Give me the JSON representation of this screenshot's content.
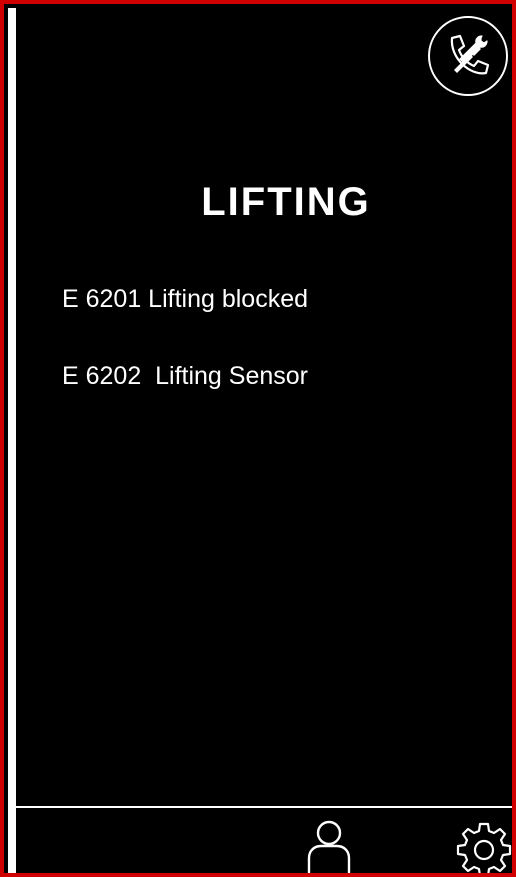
{
  "screen": {
    "title": "LIFTING"
  },
  "errors": [
    {
      "text": "E 6201 Lifting blocked"
    },
    {
      "text": "E 6202  Lifting Sensor"
    }
  ],
  "icons": {
    "service": "phone-wrench-icon",
    "user": "user-icon",
    "settings": "gear-icon"
  },
  "colors": {
    "frame": "#d00000",
    "background": "#000000",
    "foreground": "#ffffff"
  }
}
